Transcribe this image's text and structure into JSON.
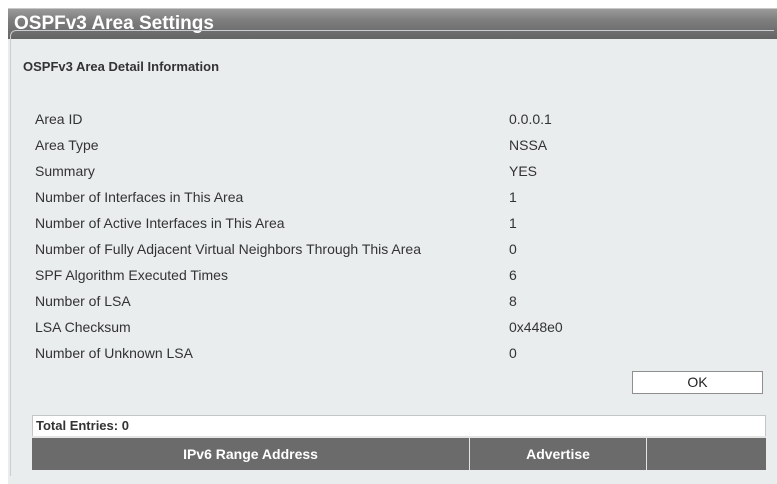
{
  "header": {
    "title": "OSPFv3 Area Settings"
  },
  "detail": {
    "legend": "OSPFv3 Area Detail Information",
    "rows": [
      {
        "label": "Area ID",
        "value": "0.0.0.1"
      },
      {
        "label": "Area Type",
        "value": "NSSA"
      },
      {
        "label": "Summary",
        "value": "YES"
      },
      {
        "label": "Number of Interfaces in This Area",
        "value": "1"
      },
      {
        "label": "Number of Active Interfaces in This Area",
        "value": "1"
      },
      {
        "label": "Number of Fully Adjacent Virtual Neighbors Through This Area",
        "value": "0"
      },
      {
        "label": "SPF Algorithm Executed Times",
        "value": "6"
      },
      {
        "label": "Number of LSA",
        "value": "8"
      },
      {
        "label": "LSA Checksum",
        "value": "0x448e0"
      },
      {
        "label": "Number of Unknown LSA",
        "value": "0"
      }
    ],
    "ok_label": "OK"
  },
  "table": {
    "total_entries_label": "Total Entries: 0",
    "columns": [
      "IPv6 Range Address",
      "Advertise",
      ""
    ]
  }
}
